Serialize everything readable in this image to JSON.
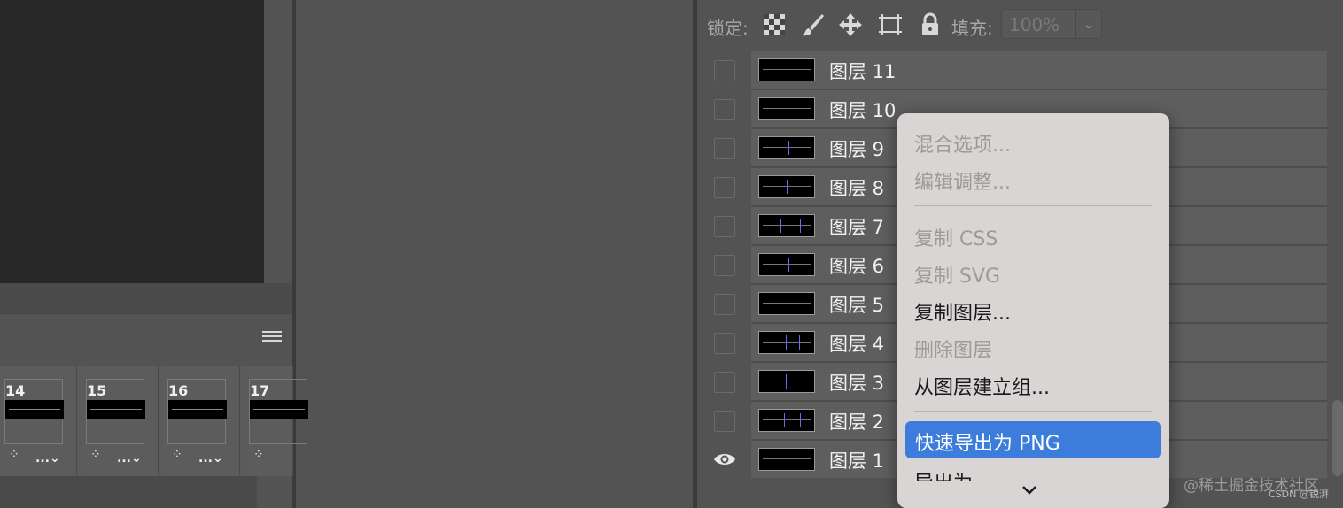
{
  "layers_panel": {
    "lock_label": "锁定:",
    "fill_label": "填充:",
    "fill_value": "100%",
    "layers": [
      {
        "name": "图层 11",
        "visible": false
      },
      {
        "name": "图层 10",
        "visible": false
      },
      {
        "name": "图层 9",
        "visible": false
      },
      {
        "name": "图层 8",
        "visible": false
      },
      {
        "name": "图层 7",
        "visible": false
      },
      {
        "name": "图层 6",
        "visible": false
      },
      {
        "name": "图层 5",
        "visible": false
      },
      {
        "name": "图层 4",
        "visible": false
      },
      {
        "name": "图层 3",
        "visible": false
      },
      {
        "name": "图层 2",
        "visible": false
      },
      {
        "name": "图层 1",
        "visible": true
      }
    ]
  },
  "timeline": {
    "frames": [
      {
        "number": "14",
        "options": "..."
      },
      {
        "number": "15",
        "options": "..."
      },
      {
        "number": "16",
        "options": "..."
      },
      {
        "number": "17",
        "options": "..."
      }
    ]
  },
  "context_menu": {
    "items": [
      {
        "label": "混合选项...",
        "enabled": false
      },
      {
        "label": "编辑调整...",
        "enabled": false
      },
      {
        "label": "复制 CSS",
        "enabled": false
      },
      {
        "label": "复制 SVG",
        "enabled": false
      },
      {
        "label": "复制图层...",
        "enabled": true
      },
      {
        "label": "删除图层",
        "enabled": false
      },
      {
        "label": "从图层建立组...",
        "enabled": true
      }
    ],
    "highlighted": "快速导出为 PNG",
    "partial_item": "导出为",
    "more_icon": "chevron-down-icon"
  },
  "watermark": {
    "main": "@稀土掘金技术社区",
    "sub": "CSDN @锐湃"
  },
  "colors": {
    "highlight": "#3c7ddb",
    "panel": "#535353",
    "menu": "#d9d5d5"
  }
}
